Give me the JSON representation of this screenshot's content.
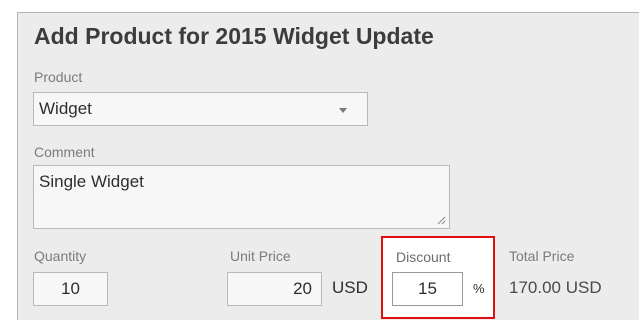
{
  "dialog": {
    "title": "Add Product for 2015 Widget Update"
  },
  "product": {
    "label": "Product",
    "value": "Widget"
  },
  "comment": {
    "label": "Comment",
    "value": "Single Widget"
  },
  "quantity": {
    "label": "Quantity",
    "value": "10"
  },
  "unit_price": {
    "label": "Unit Price",
    "value": "20",
    "currency": "USD"
  },
  "discount": {
    "label": "Discount",
    "value": "15",
    "unit": "%"
  },
  "total_price": {
    "label": "Total Price",
    "value": "170.00 USD"
  },
  "colors": {
    "highlight": "#e01010",
    "panel_bg": "#ececec"
  },
  "icons": {
    "product_dropdown": "chevron-down-icon",
    "comment_resize": "resize-grip-icon"
  }
}
